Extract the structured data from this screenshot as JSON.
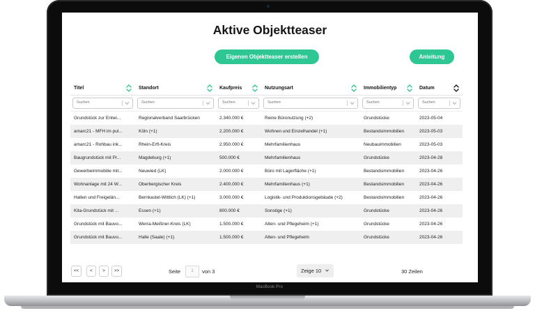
{
  "device": {
    "brand": "MacBook Pro"
  },
  "page": {
    "title": "Aktive Objektteaser",
    "create_button": "Eigenen Objektteaser erstellen",
    "help_button": "Anleitung"
  },
  "colors": {
    "accent": "#2ec794",
    "sort_inactive": "#2ec794",
    "sort_active": "#151515"
  },
  "table": {
    "filter_placeholder": "Suchen",
    "columns": [
      "Titel",
      "Standort",
      "Kaufpreis",
      "Nutzungsart",
      "Immobilientyp",
      "Datum"
    ],
    "rows": [
      [
        "Grundstück zur Entwi...",
        "Regionalverband Saarbrücken",
        "2.340.000 €",
        "Reine Büronutzung (+2)",
        "Grundstücke",
        "2023-05-04"
      ],
      [
        "amarc21 - MFH im pul...",
        "Köln (+1)",
        "2.200.000 €",
        "Wohnen und Einzelhandel (+1)",
        "Bestandsimmobilien",
        "2023-05-03"
      ],
      [
        "amarc21 - Rohbau ink...",
        "Rhein-Erft-Kreis",
        "2.950.000 €",
        "Mehrfamilienhaus",
        "Neubauimmobilien",
        "2023-05-03"
      ],
      [
        "Baugrundstück mit Pr...",
        "Magdeburg (+1)",
        "500.000 €",
        "Mehrfamilienhaus",
        "Grundstücke",
        "2023-04-28"
      ],
      [
        "Gewerbeimmobilie mit...",
        "Neuwied (LK)",
        "2.000.000 €",
        "Büro mit Lagerfläche (+1)",
        "Bestandsimmobilien",
        "2023-04-26"
      ],
      [
        "Wohnanlage mit 24 W...",
        "Oberbergischer Kreis",
        "2.400.000 €",
        "Mehrfamilienhaus (+1)",
        "Bestandsimmobilien",
        "2023-04-26"
      ],
      [
        "Hallen und Freigelän...",
        "Bernkastel-Wittlich (LK) (+1)",
        "3.000.000 €",
        "Logistik- und Produktionsgebäude (+2)",
        "Bestandsimmobilien",
        "2023-04-26"
      ],
      [
        "Kita-Grundstück mit ...",
        "Essen (+1)",
        "800.000 €",
        "Sonstige (+1)",
        "Grundstücke",
        "2023-04-26"
      ],
      [
        "Grundstück mit Bauvo...",
        "Werra-Meißner-Kreis (LK)",
        "1.500.000 €",
        "Alten- und Pflegeheim (+1)",
        "Grundstücke",
        "2023-04-26"
      ],
      [
        "Grundstück mit Bauvo...",
        "Halle (Saale) (+1)",
        "1.500.000 €",
        "Alten- und Pflegeheim",
        "Grundstücke",
        "2023-04-26"
      ]
    ]
  },
  "pagination": {
    "first": "<<",
    "prev": "<",
    "next": ">",
    "last": ">>",
    "page_label": "Seite",
    "page_value": "1",
    "of_label": "von 3",
    "page_size": "Zeige 10",
    "total": "30 Zeilen"
  }
}
